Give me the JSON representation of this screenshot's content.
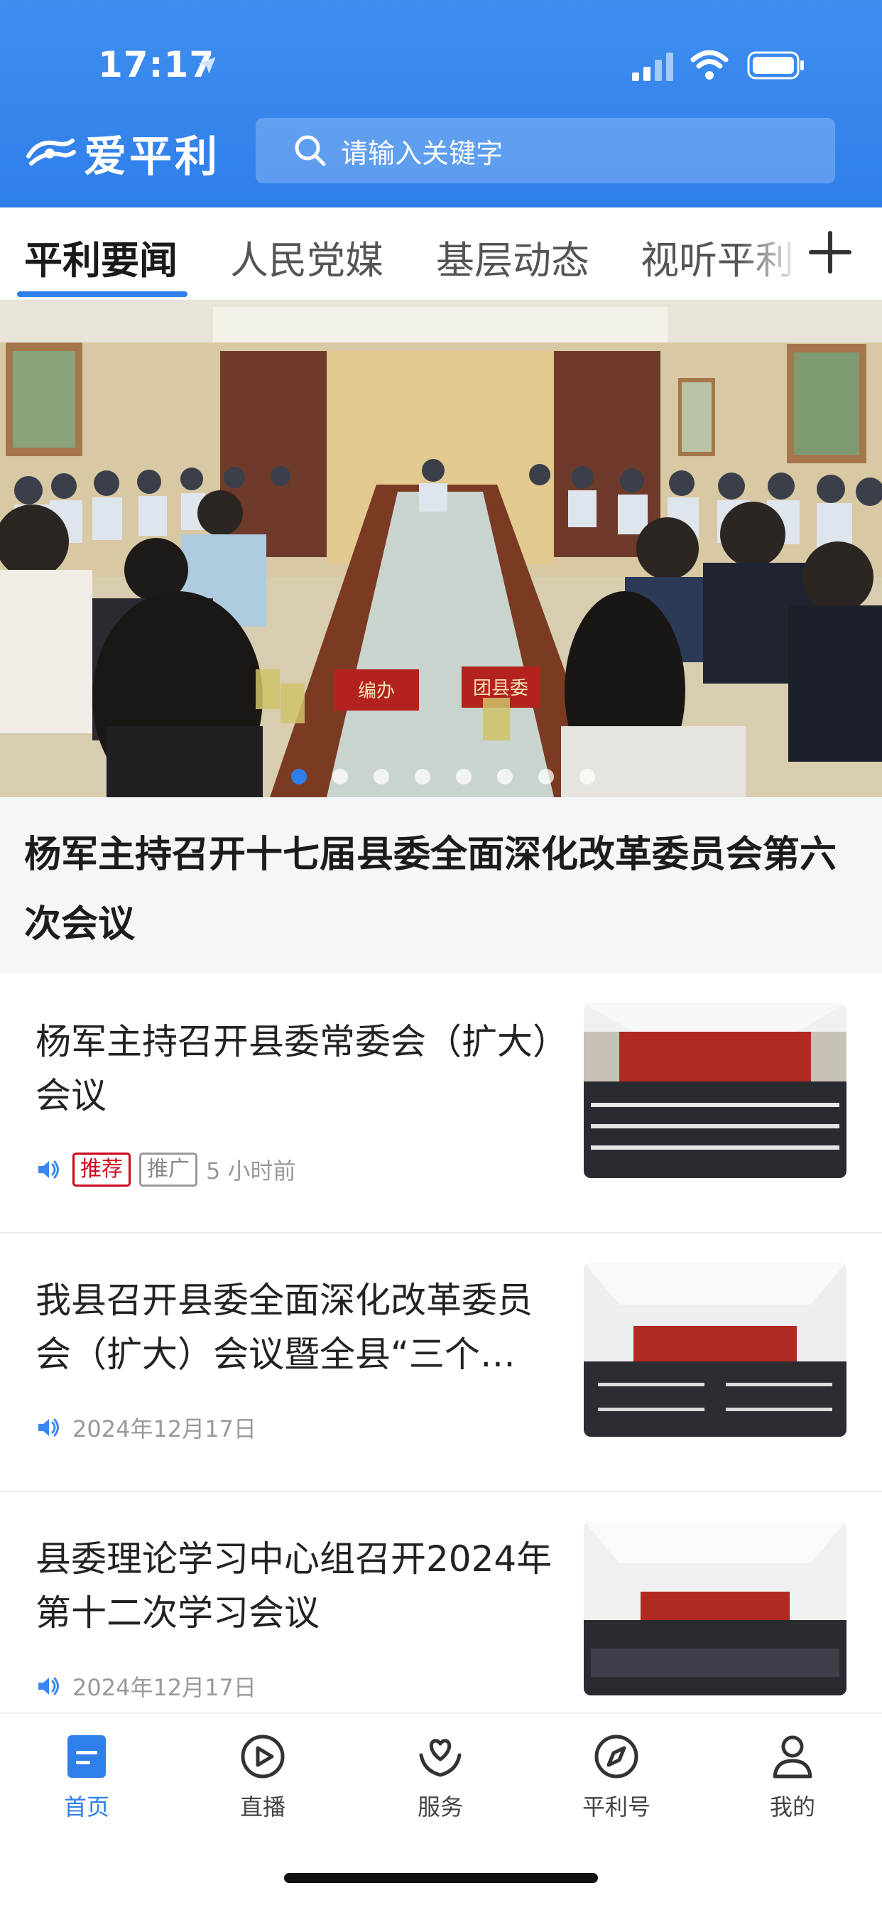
{
  "status_bar": {
    "time": "17:17"
  },
  "app": {
    "name": "爱平利",
    "search_placeholder": "请输入关键字",
    "brand_color": "#2f7fea"
  },
  "tabs": [
    {
      "label": "平利要闻",
      "active": true
    },
    {
      "label": "人民党媒",
      "active": false
    },
    {
      "label": "基层动态",
      "active": false
    },
    {
      "label": "视听平利",
      "active": false
    }
  ],
  "banner": {
    "headline": "杨军主持召开十七届县委全面深化改革委员会第六次会议",
    "slide_count": 8,
    "active_slide": 1,
    "name_plates": [
      "编办",
      "团县委"
    ]
  },
  "news": [
    {
      "title": "杨军主持召开县委常委会（扩大）会议",
      "badges": [
        "推荐",
        "推广"
      ],
      "time": "5 小时前"
    },
    {
      "title": "我县召开县委全面深化改革委员会（扩大）会议暨全县“三个…",
      "badges": [],
      "time": "2024年12月17日"
    },
    {
      "title": "县委理论学习中心组召开2024年第十二次学习会议",
      "badges": [],
      "time": "2024年12月17日"
    }
  ],
  "bottom_nav": [
    {
      "label": "首页",
      "icon": "home-icon",
      "active": true
    },
    {
      "label": "直播",
      "icon": "play-icon",
      "active": false
    },
    {
      "label": "服务",
      "icon": "service-heart-icon",
      "active": false
    },
    {
      "label": "平利号",
      "icon": "compass-icon",
      "active": false
    },
    {
      "label": "我的",
      "icon": "user-icon",
      "active": false
    }
  ]
}
